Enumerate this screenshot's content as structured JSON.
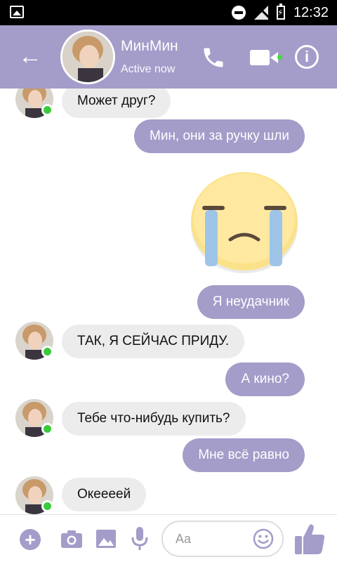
{
  "status_bar": {
    "time": "12:32"
  },
  "header": {
    "contact_name": "МинМин",
    "status": "Active now"
  },
  "messages": [
    {
      "from": "them",
      "text": "Может друг?"
    },
    {
      "from": "me",
      "text": "Мин, они за ручку шли"
    },
    {
      "from": "me",
      "sticker": "crying-face"
    },
    {
      "from": "me",
      "text": "Я неудачник"
    },
    {
      "from": "them",
      "text": "ТАК, Я СЕЙЧАС ПРИДУ."
    },
    {
      "from": "me",
      "text": "А кино?"
    },
    {
      "from": "them",
      "text": "Тебе что-нибудь купить?"
    },
    {
      "from": "me",
      "text": "Мне всё равно"
    },
    {
      "from": "them",
      "text": "Океееей"
    }
  ],
  "composer": {
    "placeholder": "Aa"
  },
  "colors": {
    "accent": "#a49cc9",
    "incoming_bubble": "#ececec",
    "online": "#3cc93c"
  }
}
